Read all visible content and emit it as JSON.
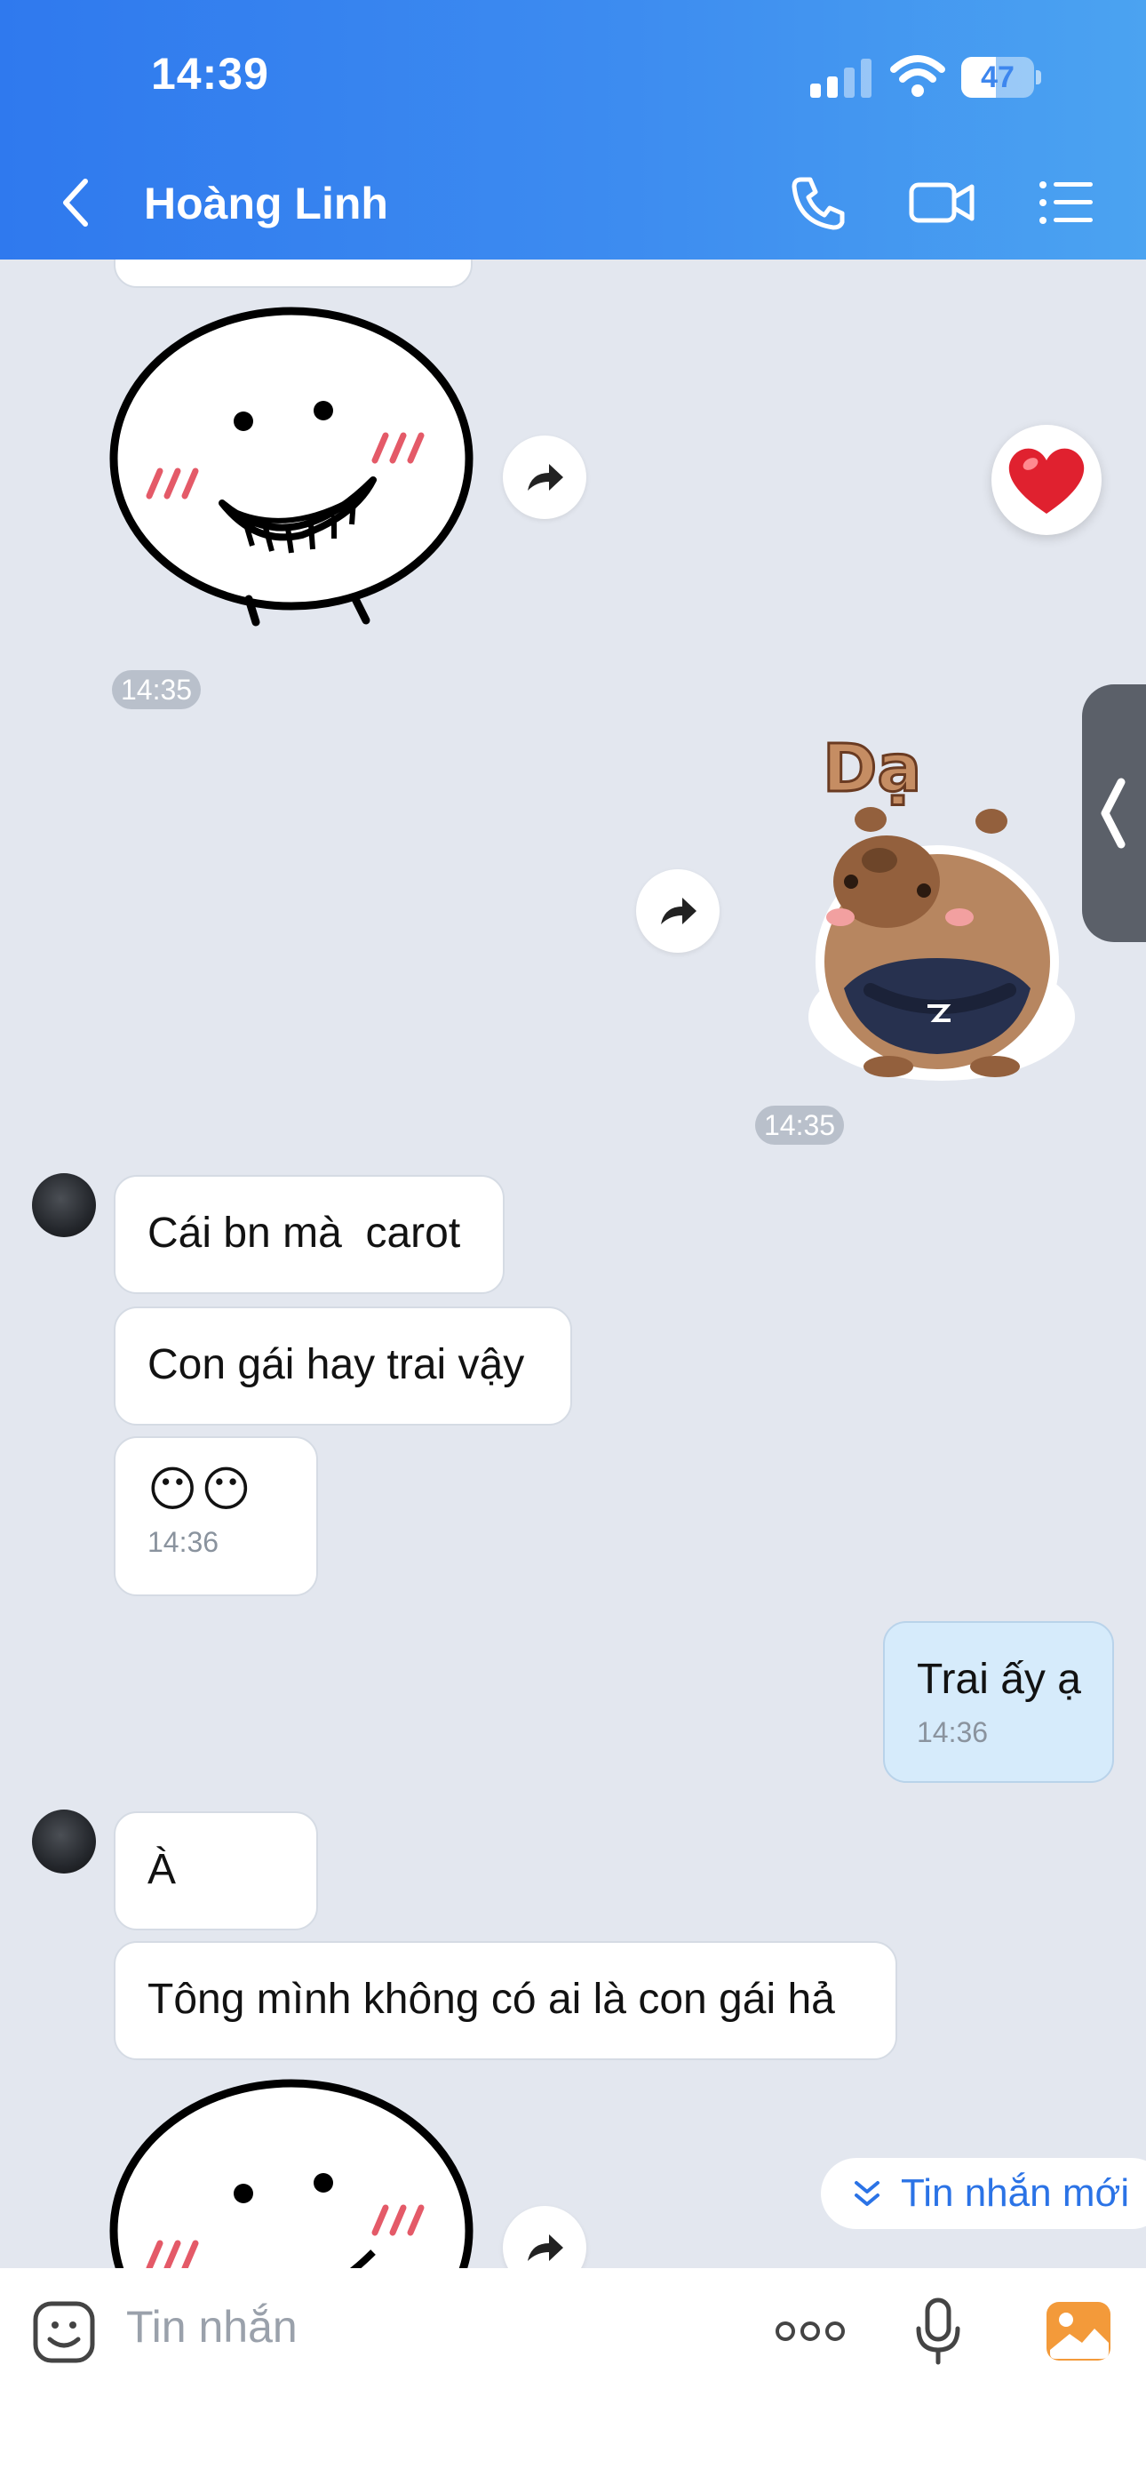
{
  "status_bar": {
    "time": "14:39",
    "battery": "47"
  },
  "header": {
    "contact_name": "Hoàng Linh",
    "icons": [
      "back-arrow-icon",
      "phone-icon",
      "video-call-icon",
      "menu-list-icon"
    ]
  },
  "messages": {
    "incoming_1": {
      "text": "Cái bn mà  carot"
    },
    "incoming_2": {
      "text": "Con gái hay trai vậy"
    },
    "incoming_3": {
      "text": "😶😶",
      "time": "14:36"
    },
    "outgoing_1": {
      "text": "Trai ấy ạ",
      "time": "14:36"
    },
    "incoming_4": {
      "text": "À"
    },
    "incoming_5": {
      "text": "Tông mình không có ai là con gái hả"
    }
  },
  "timestamps": {
    "sticker_1": "14:35",
    "sticker_2": "14:35"
  },
  "sticker_2": {
    "caption": "Dạ"
  },
  "reaction": {
    "emoji": "❤️"
  },
  "new_messages_pill": {
    "label": "Tin nhắn mới"
  },
  "composer": {
    "placeholder": "Tin nhắn",
    "icons": [
      "emoji-sticker-icon",
      "more-options-icon",
      "microphone-icon",
      "image-gallery-icon"
    ]
  },
  "colors": {
    "header_start": "#2f79ee",
    "header_end": "#4ba3f1",
    "chat_background": "#e3e7ef",
    "outgoing_bubble": "#d6ebfb",
    "accent": "#2b73e6"
  }
}
